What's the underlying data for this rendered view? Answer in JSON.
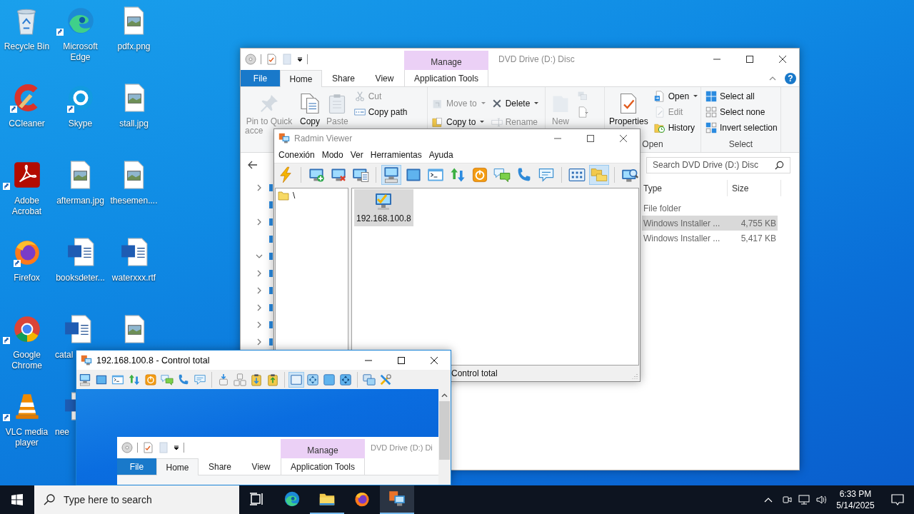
{
  "desktop_icons": [
    {
      "label": "Recycle Bin",
      "kind": "recycle",
      "shortcut": false,
      "truncated": false
    },
    {
      "label": "CCleaner",
      "kind": "ccleaner",
      "shortcut": true,
      "truncated": false
    },
    {
      "label": "Adobe Acrobat",
      "kind": "acrobat",
      "shortcut": true,
      "truncated": false
    },
    {
      "label": "Firefox",
      "kind": "firefox",
      "shortcut": true,
      "truncated": false
    },
    {
      "label": "Google Chrome",
      "kind": "chrome",
      "shortcut": true,
      "truncated": false
    },
    {
      "label": "VLC media player",
      "kind": "vlc",
      "shortcut": true,
      "truncated": false
    },
    {
      "label": "Microsoft Edge",
      "kind": "edge",
      "shortcut": true,
      "truncated": false
    },
    {
      "label": "Skype",
      "kind": "skype",
      "shortcut": true,
      "truncated": false
    },
    {
      "label": "afterman.jpg",
      "kind": "image",
      "shortcut": false,
      "truncated": false
    },
    {
      "label": "booksdeter...",
      "kind": "word",
      "shortcut": false,
      "truncated": false
    },
    {
      "label": "catal",
      "kind": "word",
      "shortcut": false,
      "truncated": true,
      "covered": false
    },
    {
      "label": "nee",
      "kind": "word",
      "shortcut": false,
      "truncated": true,
      "covered": true
    },
    {
      "label": "pdfx.png",
      "kind": "image",
      "shortcut": false,
      "truncated": false
    },
    {
      "label": "stall.jpg",
      "kind": "image",
      "shortcut": false,
      "truncated": false
    },
    {
      "label": "thesemen....",
      "kind": "image",
      "shortcut": false,
      "truncated": false
    },
    {
      "label": "waterxxx.rtf",
      "kind": "word",
      "shortcut": false,
      "truncated": false
    },
    {
      "kind": "image",
      "shortcut": false,
      "truncated": false
    }
  ],
  "explorer": {
    "title": "DVD Drive (D:) Disc",
    "context_label": "Manage",
    "tabs": [
      {
        "label": "File",
        "kind": "file",
        "selected": false
      },
      {
        "label": "Home",
        "kind": "tab",
        "selected": true
      },
      {
        "label": "Share",
        "kind": "tab",
        "selected": false
      },
      {
        "label": "View",
        "kind": "tab",
        "selected": false
      },
      {
        "label": "Application Tools",
        "kind": "context",
        "selected": false
      }
    ],
    "help": "?",
    "ribbon": [
      {
        "columns": [
          [
            {
              "label": "Pin to Quick acce",
              "kind": "pin",
              "disabled": true
            }
          ],
          [
            {
              "label": "Copy",
              "kind": "copy",
              "disabled": false
            }
          ],
          [
            {
              "label": "Paste",
              "kind": "paste",
              "disabled": true
            }
          ],
          [
            {
              "label": "Cut",
              "kind": "cut",
              "disabled": true
            },
            {
              "label": "Copy path",
              "kind": "copypath",
              "disabled": false
            }
          ]
        ]
      },
      {
        "columns": [
          [
            {
              "label": "Move to",
              "kind": "moveto",
              "disabled": true,
              "dropdown": true
            },
            {
              "label": "Copy to",
              "kind": "copyto",
              "disabled": false,
              "dropdown": true
            }
          ],
          [
            {
              "label": "Delete",
              "kind": "delete",
              "disabled": false,
              "dropdown": true
            },
            {
              "label": "Rename",
              "kind": "rename",
              "disabled": true,
              "dropdown": false
            }
          ]
        ]
      },
      {
        "columns": [
          [
            {
              "label": "New",
              "kind": "newfolder",
              "disabled": true
            }
          ],
          [
            {
              "kind": "newitem",
              "disabled": true
            },
            {
              "kind": "easyaccess",
              "disabled": false
            }
          ]
        ]
      },
      {
        "label": "Open",
        "columns": [
          [
            {
              "label": "Properties",
              "kind": "properties",
              "disabled": false
            }
          ],
          [
            {
              "label": "Open",
              "kind": "open",
              "disabled": false,
              "dropdown": true
            },
            {
              "label": "Edit",
              "kind": "edit",
              "disabled": true,
              "dropdown": false
            },
            {
              "label": "History",
              "kind": "history",
              "disabled": false,
              "dropdown": false
            }
          ]
        ]
      },
      {
        "label": "Select",
        "columns": [
          [
            {
              "label": "Select all",
              "kind": "selectall",
              "disabled": false
            },
            {
              "label": "Select none",
              "kind": "selectnone",
              "disabled": false
            },
            {
              "label": "Invert selection",
              "kind": "invert",
              "disabled": false
            }
          ]
        ]
      }
    ],
    "search": {
      "placeholder": "Search DVD Drive (D:) Disc"
    },
    "nav_items": [
      {
        "kind": "branch",
        "expanded": false
      },
      {
        "kind": "leaf"
      },
      {
        "kind": "branch",
        "expanded": false
      },
      {
        "kind": "leaf"
      },
      {
        "kind": "branch",
        "expanded": true
      },
      {
        "kind": "branch",
        "expanded": false
      },
      {
        "kind": "branch",
        "expanded": false
      },
      {
        "kind": "branch",
        "expanded": false
      },
      {
        "kind": "branch",
        "expanded": false
      },
      {
        "kind": "branch",
        "expanded": false
      }
    ],
    "columns": [
      "Type",
      "Size"
    ],
    "rows": [
      {
        "type": "File folder",
        "selected": false
      },
      {
        "type": "Windows Installer ...",
        "size": "4,755 KB",
        "selected": true
      },
      {
        "type": "Windows Installer ...",
        "size": "5,417 KB",
        "selected": false
      }
    ]
  },
  "radmin": {
    "title": "Radmin Viewer",
    "menu": [
      "Conexión",
      "Modo",
      "Ver",
      "Herramientas",
      "Ayuda"
    ],
    "toolbar": [
      [
        {
          "kind": "connect",
          "selected": false
        }
      ],
      [
        {
          "kind": "add",
          "selected": false
        },
        {
          "kind": "remove",
          "selected": false
        },
        {
          "kind": "props",
          "selected": false
        }
      ],
      [
        {
          "kind": "fullcontrol",
          "selected": true
        },
        {
          "kind": "view",
          "selected": false
        },
        {
          "kind": "telnet",
          "selected": false
        },
        {
          "kind": "transfer",
          "selected": false
        },
        {
          "kind": "shutdown",
          "selected": false
        },
        {
          "kind": "chat",
          "selected": false
        },
        {
          "kind": "voice",
          "selected": false
        },
        {
          "kind": "message",
          "selected": false
        }
      ],
      [
        {
          "kind": "largeicons",
          "selected": false
        },
        {
          "kind": "folders",
          "selected": true
        }
      ],
      [
        {
          "kind": "scan",
          "selected": false
        }
      ]
    ],
    "tree": [
      "\\"
    ],
    "connections": [
      {
        "label": "192.168.100.8",
        "selected": true
      }
    ],
    "status": "Control total"
  },
  "control_window": {
    "title": "192.168.100.8 - Control total",
    "toolbar": [
      [
        {
          "kind": "fullcontrol",
          "selected": false
        },
        {
          "kind": "view",
          "selected": false
        },
        {
          "kind": "telnet",
          "selected": false
        },
        {
          "kind": "transfer",
          "selected": false
        },
        {
          "kind": "shutdown",
          "selected": false
        },
        {
          "kind": "chat",
          "selected": false
        },
        {
          "kind": "voice",
          "selected": false
        },
        {
          "kind": "message",
          "selected": false
        }
      ],
      [
        {
          "kind": "sendkeys",
          "selected": false
        },
        {
          "kind": "keys",
          "selected": false
        },
        {
          "kind": "clipget",
          "selected": false
        },
        {
          "kind": "clipput",
          "selected": false
        }
      ],
      [
        {
          "kind": "normal",
          "selected": true
        },
        {
          "kind": "scaled",
          "selected": false
        },
        {
          "kind": "fullscreen",
          "selected": false
        },
        {
          "kind": "fullscaled",
          "selected": false
        }
      ],
      [
        {
          "kind": "monitors",
          "selected": false
        },
        {
          "kind": "tools",
          "selected": false
        }
      ]
    ],
    "remote_explorer": {
      "title": "DVD Drive (D:) Di",
      "context_label": "Manage",
      "tabs": [
        {
          "label": "File",
          "kind": "file",
          "selected": false
        },
        {
          "label": "Home",
          "kind": "tab",
          "selected": true
        },
        {
          "label": "Share",
          "kind": "tab",
          "selected": false
        },
        {
          "label": "View",
          "kind": "tab",
          "selected": false
        },
        {
          "label": "Application Tools",
          "kind": "context",
          "selected": false
        }
      ]
    }
  },
  "taskbar": {
    "search": {
      "placeholder": "Type here to search"
    },
    "apps": [
      {
        "kind": "edge",
        "running": false,
        "selected": false
      },
      {
        "kind": "explorer",
        "running": true,
        "selected": false
      },
      {
        "kind": "firefox",
        "running": false,
        "selected": false
      },
      {
        "kind": "radmin",
        "running": true,
        "selected": true
      }
    ],
    "time": "6:33 PM",
    "date": "5/14/2025"
  }
}
